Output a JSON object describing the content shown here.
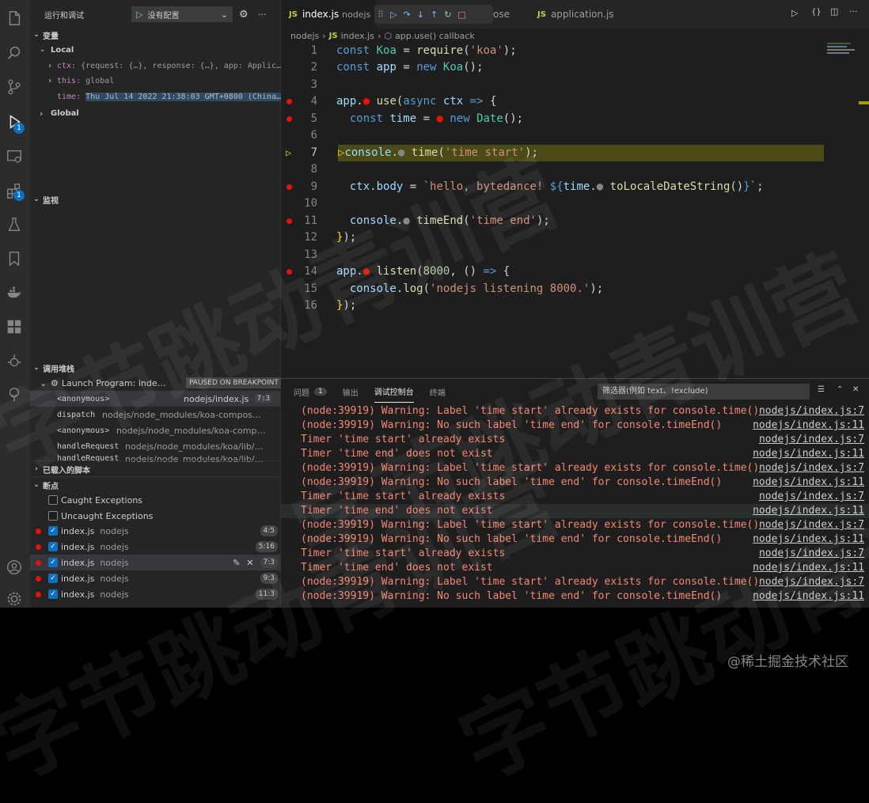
{
  "debug_toolbar": {
    "title": "运行和调试",
    "config": "没有配置"
  },
  "variables": {
    "header": "变量",
    "local_header": "Local",
    "items": [
      {
        "key": "ctx:",
        "value": "{request: {…}, response: {…}, app: Applic…"
      },
      {
        "key": "this:",
        "value": "global"
      },
      {
        "key": "time:",
        "value": "Thu Jul 14 2022 21:38:03 GMT+0800 (China…"
      }
    ],
    "global_header": "Global"
  },
  "watch": {
    "header": "监视"
  },
  "callstack": {
    "header": "调用堆栈",
    "program": "Launch Program: inde…",
    "status": "PAUSED ON BREAKPOINT",
    "frames": [
      {
        "name": "<anonymous>",
        "file": "nodejs/index.js",
        "pos": "7:3"
      },
      {
        "name": "dispatch",
        "file": "nodejs/node_modules/koa-compos…",
        "pos": ""
      },
      {
        "name": "<anonymous>",
        "file": "nodejs/node_modules/koa-comp…",
        "pos": ""
      },
      {
        "name": "handleRequest",
        "file": "nodejs/node_modules/koa/lib/…",
        "pos": ""
      },
      {
        "name": "handleRequest",
        "file": "nodejs/node_modules/koa/lib/…",
        "pos": ""
      }
    ]
  },
  "loaded_scripts": {
    "header": "已载入的脚本"
  },
  "breakpoints": {
    "header": "断点",
    "caught": "Caught Exceptions",
    "uncaught": "Uncaught Exceptions",
    "items": [
      {
        "file": "index.js",
        "dir": "nodejs",
        "pos": "4:5"
      },
      {
        "file": "index.js",
        "dir": "nodejs",
        "pos": "5:16"
      },
      {
        "file": "index.js",
        "dir": "nodejs",
        "pos": "7:3"
      },
      {
        "file": "index.js",
        "dir": "nodejs",
        "pos": "9:3"
      },
      {
        "file": "index.js",
        "dir": "nodejs",
        "pos": "11:3"
      }
    ]
  },
  "tabs": [
    {
      "label": "index.js",
      "sub": "nodejs",
      "prefix": "JS"
    },
    {
      "label": "ose",
      "sub": "",
      "prefix": ""
    },
    {
      "label": "application.js",
      "sub": "",
      "prefix": "JS"
    }
  ],
  "breadcrumb": {
    "folder": "nodejs",
    "file": "index.js",
    "symbol": "app.use() callback"
  },
  "code": {
    "line_numbers": [
      "1",
      "2",
      "3",
      "4",
      "5",
      "6",
      "7",
      "8",
      "9",
      "10",
      "11",
      "12",
      "13",
      "14",
      "15",
      "16"
    ],
    "current_line": "7"
  },
  "panel": {
    "tabs": {
      "problems": "问题",
      "problems_count": "1",
      "output": "输出",
      "debug_console": "调试控制台",
      "terminal": "终端"
    },
    "filter_placeholder": "筛选器(例如 text、!exclude)",
    "lines": [
      {
        "msg": "(node:39919) Warning: Label 'time start' already exists for console.time()",
        "loc": "nodejs/index.js:7"
      },
      {
        "msg": "(node:39919) Warning: No such label 'time end' for console.timeEnd()",
        "loc": "nodejs/index.js:11"
      },
      {
        "msg": "Timer 'time start' already exists",
        "loc": "nodejs/index.js:7"
      },
      {
        "msg": "Timer 'time end' does not exist",
        "loc": "nodejs/index.js:11"
      },
      {
        "msg": "(node:39919) Warning: Label 'time start' already exists for console.time()",
        "loc": "nodejs/index.js:7"
      },
      {
        "msg": "(node:39919) Warning: No such label 'time end' for console.timeEnd()",
        "loc": "nodejs/index.js:11"
      },
      {
        "msg": "Timer 'time start' already exists",
        "loc": "nodejs/index.js:7"
      },
      {
        "msg": "Timer 'time end' does not exist",
        "loc": "nodejs/index.js:11"
      },
      {
        "msg": "(node:39919) Warning: Label 'time start' already exists for console.time()",
        "loc": "nodejs/index.js:7"
      },
      {
        "msg": "(node:39919) Warning: No such label 'time end' for console.timeEnd()",
        "loc": "nodejs/index.js:11"
      },
      {
        "msg": "Timer 'time start' already exists",
        "loc": "nodejs/index.js:7"
      },
      {
        "msg": "Timer 'time end' does not exist",
        "loc": "nodejs/index.js:11"
      },
      {
        "msg": "(node:39919) Warning: Label 'time start' already exists for console.time()",
        "loc": "nodejs/index.js:7"
      },
      {
        "msg": "(node:39919) Warning: No such label 'time end' for console.timeEnd()",
        "loc": "nodejs/index.js:11"
      }
    ]
  },
  "watermark": {
    "text": "字节跳动青训营",
    "credit": "@稀土掘金技术社区"
  },
  "activity_badges": {
    "debug": "1",
    "extensions": "1"
  }
}
